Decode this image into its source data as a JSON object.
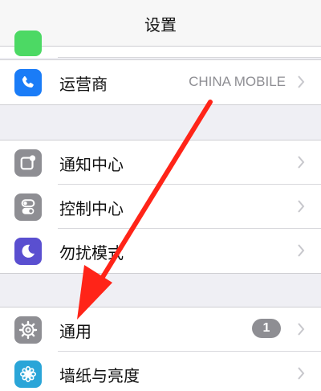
{
  "navbar": {
    "title": "设置"
  },
  "groups": [
    {
      "rows": [
        {
          "label": "运营商",
          "value": "CHINA MOBILE",
          "icon": "phone-icon",
          "color": "#1a7cf7"
        }
      ]
    },
    {
      "rows": [
        {
          "label": "通知中心",
          "icon": "notification-center-icon",
          "color": "#8e8e93"
        },
        {
          "label": "控制中心",
          "icon": "control-center-icon",
          "color": "#8e8e93"
        },
        {
          "label": "勿扰模式",
          "icon": "moon-icon",
          "color": "#5a4fd0"
        }
      ]
    },
    {
      "rows": [
        {
          "label": "通用",
          "badge": "1",
          "icon": "gear-icon",
          "color": "#8e8e93"
        },
        {
          "label": "墙纸与亮度",
          "icon": "flower-icon",
          "color": "#2aa5d8"
        }
      ]
    }
  ],
  "annotation": {
    "arrow_color": "#ff2418",
    "partial_icon_color": "#4cd964"
  }
}
